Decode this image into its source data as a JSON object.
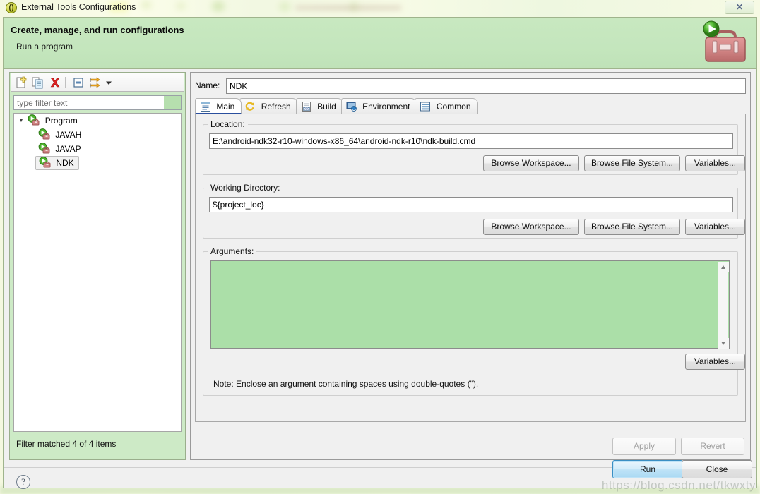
{
  "window": {
    "title": "External Tools Configurations",
    "title_icon": "app-icon",
    "close_label": "✕"
  },
  "header": {
    "title": "Create, manage, and run configurations",
    "subtitle": "Run a program",
    "art_icon": "toolbox-run-icon"
  },
  "left_panel": {
    "toolbar": [
      {
        "name": "new-configuration-icon",
        "tooltip": "New launch configuration"
      },
      {
        "name": "duplicate-configuration-icon",
        "tooltip": "Duplicate"
      },
      {
        "name": "delete-configuration-icon",
        "tooltip": "Delete"
      },
      {
        "name": "collapse-all-icon",
        "tooltip": "Collapse All"
      },
      {
        "name": "filter-launch-configurations-icon",
        "tooltip": "Filter"
      },
      {
        "name": "view-menu-chevron-icon",
        "tooltip": "View Menu"
      }
    ],
    "filter": {
      "placeholder": "type filter text",
      "value": ""
    },
    "tree": [
      {
        "label": "Program",
        "level": 0,
        "expanded": true,
        "selected": false,
        "icon": "program-config-icon"
      },
      {
        "label": "JAVAH",
        "level": 1,
        "expanded": false,
        "selected": false,
        "icon": "program-config-icon"
      },
      {
        "label": "JAVAP",
        "level": 1,
        "expanded": false,
        "selected": false,
        "icon": "program-config-icon"
      },
      {
        "label": "NDK",
        "level": 1,
        "expanded": false,
        "selected": true,
        "icon": "program-config-icon"
      }
    ],
    "status": "Filter matched 4 of 4 items"
  },
  "right_panel": {
    "name_label": "Name:",
    "name_value": "NDK",
    "tabs": [
      {
        "label": "Main",
        "icon": "main-tab-icon",
        "selected": true
      },
      {
        "label": "Refresh",
        "icon": "refresh-tab-icon",
        "selected": false
      },
      {
        "label": "Build",
        "icon": "build-tab-icon",
        "selected": false
      },
      {
        "label": "Environment",
        "icon": "environment-tab-icon",
        "selected": false
      },
      {
        "label": "Common",
        "icon": "common-tab-icon",
        "selected": false
      }
    ],
    "location": {
      "group_title": "Location:",
      "value": "E:\\android-ndk32-r10-windows-x86_64\\android-ndk-r10\\ndk-build.cmd",
      "buttons": [
        "Browse Workspace...",
        "Browse File System...",
        "Variables..."
      ]
    },
    "working_directory": {
      "group_title": "Working Directory:",
      "value": "${project_loc}",
      "buttons": [
        "Browse Workspace...",
        "Browse File System...",
        "Variables..."
      ]
    },
    "arguments": {
      "group_title": "Arguments:",
      "value": "",
      "variables_button": "Variables...",
      "note": "Note: Enclose an argument containing spaces using double-quotes (\")."
    },
    "apply_label": "Apply",
    "apply_enabled": false,
    "revert_label": "Revert",
    "revert_enabled": false
  },
  "footer": {
    "help_label": "?",
    "run_label": "Run",
    "close_label": "Close"
  },
  "watermark": "https://blog.csdn.net/tkwxty",
  "colors": {
    "header_green": "#c4e6bd",
    "panel_green": "#cdeac6",
    "args_green": "#abdfa8",
    "accent_blue": "#2a4f9e",
    "primary_button": "#a9d9f3"
  }
}
